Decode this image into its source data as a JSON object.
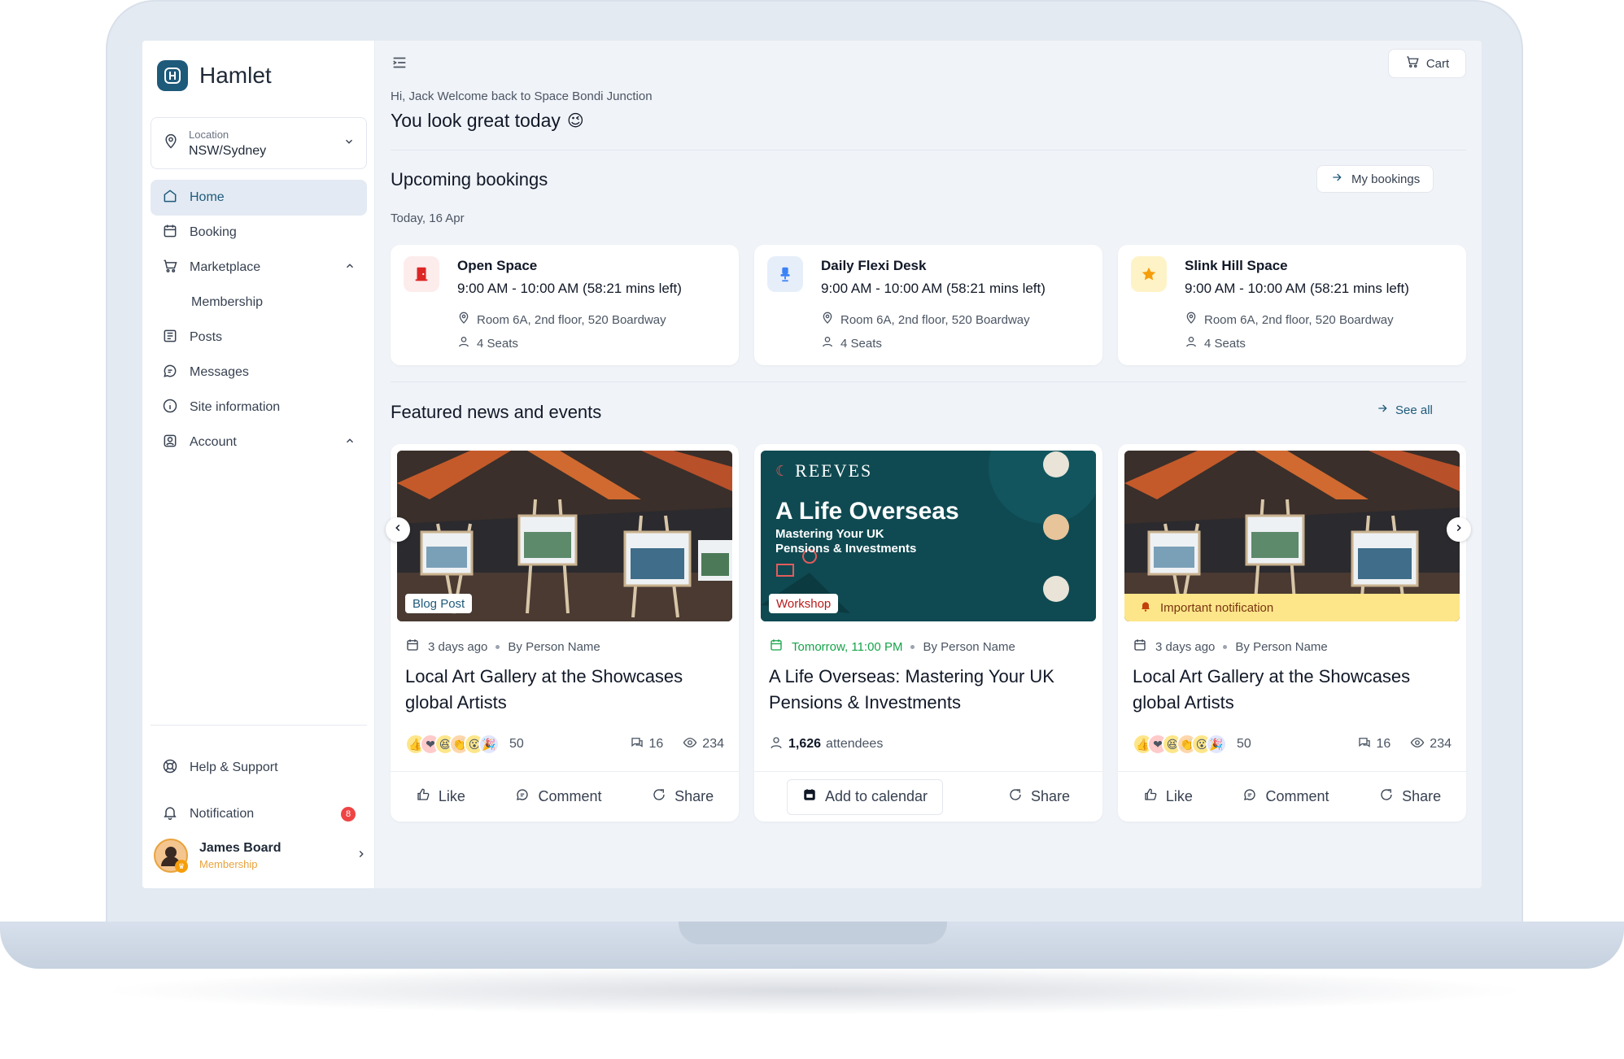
{
  "sidebar": {
    "brand": "Hamlet",
    "location": {
      "label": "Location",
      "value": "NSW/Sydney"
    },
    "nav": {
      "home": "Home",
      "booking": "Booking",
      "marketplace": "Marketplace",
      "membership": "Membership",
      "posts": "Posts",
      "messages": "Messages",
      "site_info": "Site information",
      "account": "Account"
    },
    "help": "Help & Support",
    "notification": "Notification",
    "notification_count": "8",
    "user": {
      "name": "James Board",
      "role": "Membership"
    }
  },
  "header": {
    "cart": "Cart",
    "greeting_sub": "Hi, Jack Welcome back to Space Bondi Junction",
    "greeting_title": "You look great today",
    "emoji": "😉"
  },
  "bookings": {
    "title": "Upcoming bookings",
    "my_bookings": "My bookings",
    "date": "Today, 16 Apr",
    "items": [
      {
        "name": "Open Space",
        "time": "9:00 AM - 10:00 AM (58:21 mins left)",
        "location": "Room 6A, 2nd floor, 520 Boardway",
        "seats": "4 Seats",
        "icon": "door-icon",
        "color": "#dc2626",
        "bg": "#fdecec"
      },
      {
        "name": "Daily Flexi Desk",
        "time": "9:00 AM - 10:00 AM (58:21 mins left)",
        "location": "Room 6A, 2nd floor, 520 Boardway",
        "seats": "4 Seats",
        "icon": "chair-icon",
        "color": "#3b82f6",
        "bg": "#e6eefa"
      },
      {
        "name": "Slink Hill Space",
        "time": "9:00 AM - 10:00 AM (58:21 mins left)",
        "location": "Room 6A, 2nd floor, 520 Boardway",
        "seats": "4 Seats",
        "icon": "star-icon",
        "color": "#f59e0b",
        "bg": "#fef3c7"
      }
    ]
  },
  "featured": {
    "title": "Featured news and events",
    "see_all": "See all",
    "cards": [
      {
        "tag": "Blog Post",
        "time": "3 days ago",
        "author": "By Person Name",
        "title": "Local Art Gallery at the Showcases global Artists",
        "reactions": "50",
        "comments": "16",
        "views": "234",
        "like": "Like",
        "comment": "Comment",
        "share": "Share"
      },
      {
        "tag": "Workshop",
        "time": "Tomorrow, 11:00 PM",
        "author": "By Person Name",
        "title": "A Life Overseas: Mastering Your UK Pensions & Investments",
        "attendees": "1,626",
        "attendees_label": "attendees",
        "add_calendar": "Add to calendar",
        "share": "Share",
        "poster": {
          "brand": "REEVES",
          "headline": "A Life Overseas",
          "subline1": "Mastering Your UK",
          "subline2": "Pensions & Investments"
        }
      },
      {
        "notice": "Important notification",
        "time": "3 days ago",
        "author": "By Person Name",
        "title": "Local Art Gallery at the Showcases global Artists",
        "reactions": "50",
        "comments": "16",
        "views": "234",
        "like": "Like",
        "comment": "Comment",
        "share": "Share"
      }
    ]
  },
  "colors": {
    "accent": "#1e5a7a",
    "workshop_green": "#16a34a",
    "blog_blue": "#1e5a7a",
    "workshop_red": "#b91c1c"
  }
}
